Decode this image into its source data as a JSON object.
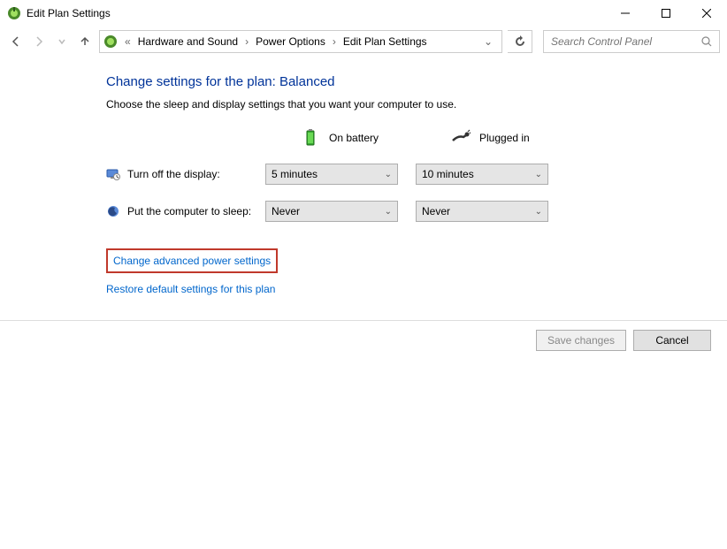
{
  "titlebar": {
    "title": "Edit Plan Settings"
  },
  "breadcrumb": {
    "items": [
      "Hardware and Sound",
      "Power Options",
      "Edit Plan Settings"
    ]
  },
  "search": {
    "placeholder": "Search Control Panel"
  },
  "page": {
    "heading": "Change settings for the plan: Balanced",
    "subheading": "Choose the sleep and display settings that you want your computer to use.",
    "col_battery": "On battery",
    "col_plugged": "Plugged in",
    "row_display": "Turn off the display:",
    "row_sleep": "Put the computer to sleep:",
    "display_battery": "5 minutes",
    "display_plugged": "10 minutes",
    "sleep_battery": "Never",
    "sleep_plugged": "Never",
    "link_advanced": "Change advanced power settings",
    "link_restore": "Restore default settings for this plan"
  },
  "footer": {
    "save": "Save changes",
    "cancel": "Cancel"
  }
}
